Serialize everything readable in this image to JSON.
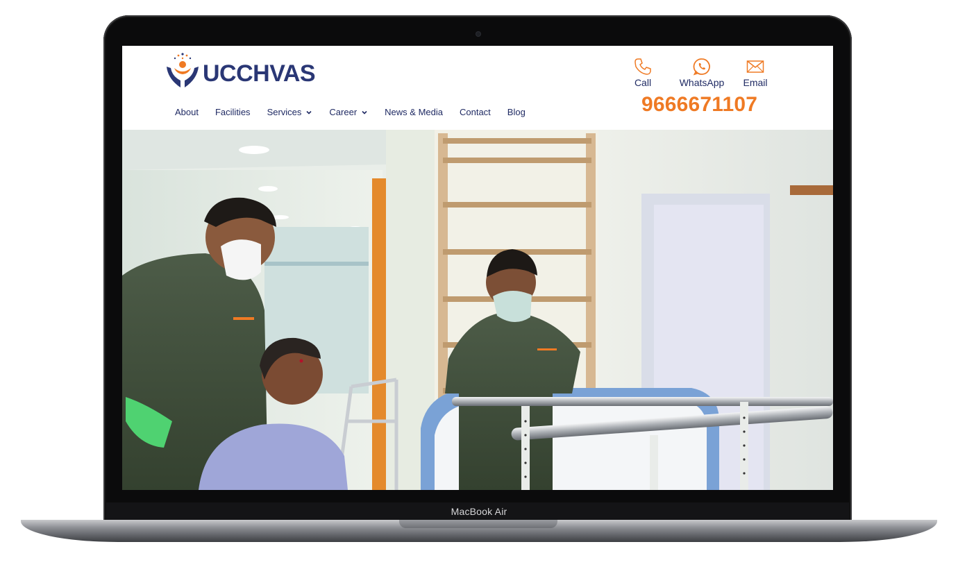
{
  "device": {
    "model_label": "MacBook Air"
  },
  "brand": {
    "name": "UCCHVAS",
    "primary_color": "#2a3775",
    "accent_color": "#ef7a24"
  },
  "nav": {
    "items": [
      {
        "label": "About",
        "has_dropdown": false
      },
      {
        "label": "Facilities",
        "has_dropdown": false
      },
      {
        "label": "Services",
        "has_dropdown": true
      },
      {
        "label": "Career",
        "has_dropdown": true
      },
      {
        "label": "News & Media",
        "has_dropdown": false
      },
      {
        "label": "Contact",
        "has_dropdown": false
      },
      {
        "label": "Blog",
        "has_dropdown": false
      }
    ]
  },
  "contact": {
    "call_label": "Call",
    "whatsapp_label": "WhatsApp",
    "email_label": "Email",
    "phone_number": "9666671107",
    "icons": [
      "phone-icon",
      "whatsapp-icon",
      "mail-icon"
    ]
  },
  "hero": {
    "media": "physiotherapy-video-frame"
  }
}
